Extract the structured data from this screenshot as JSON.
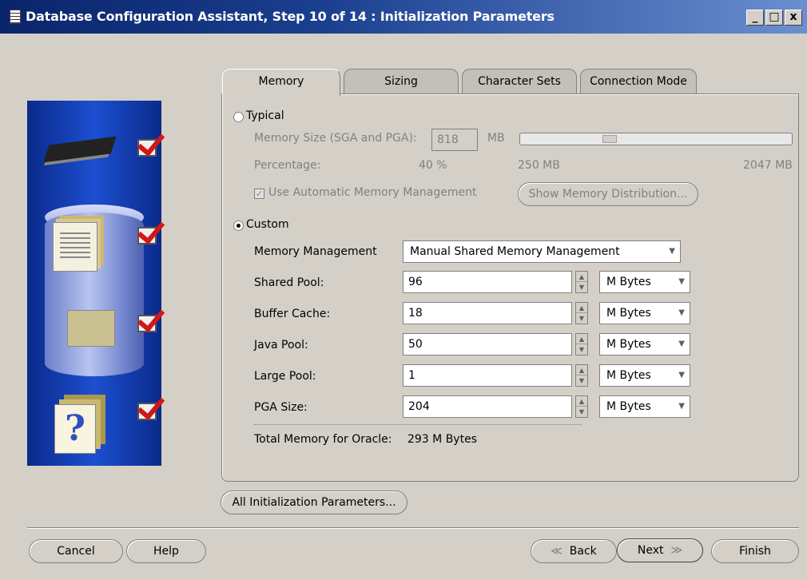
{
  "window": {
    "title": "Database Configuration Assistant, Step 10 of 14 : Initialization Parameters",
    "controls": {
      "minimize": "_",
      "maximize": "□",
      "close": "x"
    }
  },
  "side_panel": {
    "icons": [
      "chip-icon",
      "documents-icon",
      "database-icon",
      "shapes-icon",
      "folders-icon",
      "help-document-icon"
    ],
    "question_glyph": "?"
  },
  "tabs": [
    {
      "label": "Memory",
      "active": true
    },
    {
      "label": "Sizing",
      "active": false
    },
    {
      "label": "Character Sets",
      "active": false
    },
    {
      "label": "Connection Mode",
      "active": false
    }
  ],
  "typical": {
    "label": "Typical",
    "selected": false,
    "memory_size_label": "Memory Size (SGA and PGA):",
    "memory_size_value": "818",
    "memory_size_unit": "MB",
    "percentage_label": "Percentage:",
    "percentage_value": "40 %",
    "slider_min_label": "250 MB",
    "slider_max_label": "2047 MB",
    "slider_fraction": 0.32,
    "auto_memory_label": "Use Automatic Memory Management",
    "auto_memory_checked": true,
    "show_distribution_button": "Show Memory Distribution..."
  },
  "custom": {
    "label": "Custom",
    "selected": true,
    "memory_management_label": "Memory Management",
    "memory_management_value": "Manual Shared Memory Management",
    "params": [
      {
        "label": "Shared Pool:",
        "value": "96",
        "unit": "M Bytes"
      },
      {
        "label": "Buffer Cache:",
        "value": "18",
        "unit": "M Bytes"
      },
      {
        "label": "Java Pool:",
        "value": "50",
        "unit": "M Bytes"
      },
      {
        "label": "Large Pool:",
        "value": "1",
        "unit": "M Bytes"
      },
      {
        "label": "PGA Size:",
        "value": "204",
        "unit": "M Bytes"
      }
    ],
    "total_label": "Total Memory for Oracle:",
    "total_value": "293 M Bytes"
  },
  "all_params_button": "All Initialization Parameters...",
  "footer": {
    "cancel": "Cancel",
    "help": "Help",
    "back": "Back",
    "next": "Next",
    "finish": "Finish",
    "back_arrow": "≪",
    "next_arrow": "≫"
  }
}
